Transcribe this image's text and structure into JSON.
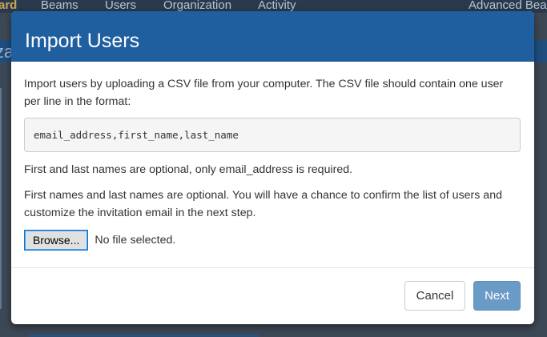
{
  "background": {
    "nav_items": [
      "ard",
      "Beams",
      "Users",
      "Organization",
      "Activity",
      "Advanced Bea"
    ],
    "band_text": "za"
  },
  "modal": {
    "title": "Import Users",
    "intro_text": "Import users by uploading a CSV file from your computer. The CSV file should contain one user per line in the format:",
    "csv_format": "email_address,first_name,last_name",
    "optional_note": "First and last names are optional, only email_address is required.",
    "confirm_note": "First names and last names are optional. You will have a chance to confirm the list of users and customize the invitation email in the next step.",
    "file_input": {
      "browse_label": "Browse...",
      "status": "No file selected."
    },
    "footer": {
      "cancel_label": "Cancel",
      "next_label": "Next"
    }
  },
  "colors": {
    "header_bg": "#1f5fa0",
    "next_button_bg": "#6a9bc6",
    "backdrop": "#3d4856"
  }
}
